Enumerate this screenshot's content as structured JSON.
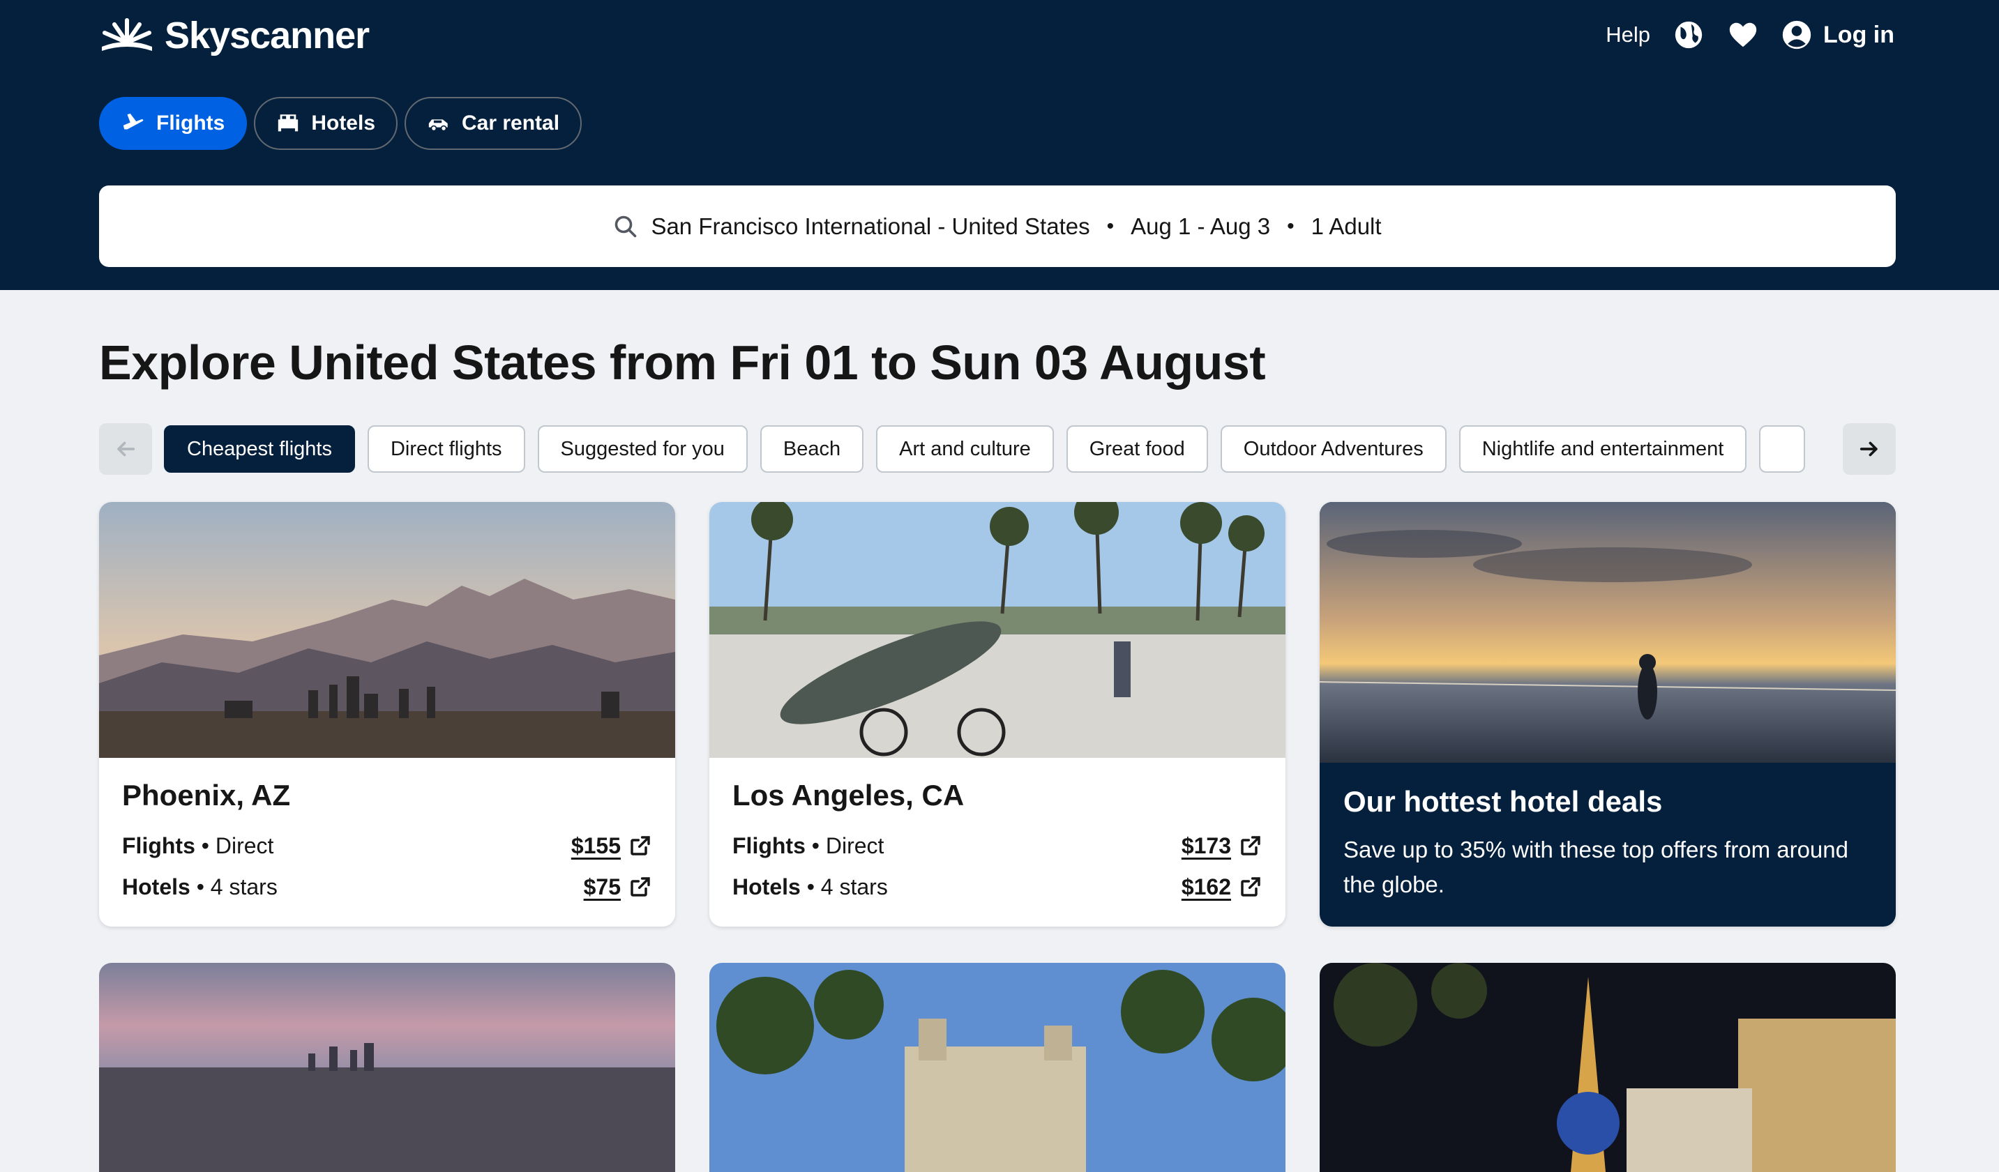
{
  "brand": {
    "name": "Skyscanner"
  },
  "topnav": {
    "help": "Help",
    "login": "Log in",
    "icons": [
      "globe-icon",
      "heart-icon",
      "user-icon"
    ]
  },
  "tabs": [
    {
      "label": "Flights",
      "icon": "plane-icon",
      "active": true
    },
    {
      "label": "Hotels",
      "icon": "bed-icon",
      "active": false
    },
    {
      "label": "Car rental",
      "icon": "car-icon",
      "active": false
    }
  ],
  "search": {
    "origin": "San Francisco International - United States",
    "dates": "Aug 1 - Aug 3",
    "travellers": "1 Adult",
    "separator": "•"
  },
  "page": {
    "heading": "Explore United States from Fri 01 to Sun 03 August"
  },
  "chips": [
    {
      "label": "Cheapest flights",
      "active": true
    },
    {
      "label": "Direct flights"
    },
    {
      "label": "Suggested for you"
    },
    {
      "label": "Beach"
    },
    {
      "label": "Art and culture"
    },
    {
      "label": "Great food"
    },
    {
      "label": "Outdoor Adventures"
    },
    {
      "label": "Nightlife and entertainment"
    },
    {
      "label": ""
    }
  ],
  "destinations": [
    {
      "city": "Phoenix, AZ",
      "flights_label": "Flights",
      "flights_detail": "Direct",
      "flights_price": "$155",
      "hotels_label": "Hotels",
      "hotels_detail": "4 stars",
      "hotels_price": "$75"
    },
    {
      "city": "Los Angeles, CA",
      "flights_label": "Flights",
      "flights_detail": "Direct",
      "flights_price": "$173",
      "hotels_label": "Hotels",
      "hotels_detail": "4 stars",
      "hotels_price": "$162"
    }
  ],
  "promo": {
    "title": "Our hottest hotel deals",
    "text": "Save up to 35% with these top offers from around the globe."
  },
  "colors": {
    "header_bg": "#05203c",
    "accent": "#0062e3",
    "page_bg": "#eff1f5"
  }
}
